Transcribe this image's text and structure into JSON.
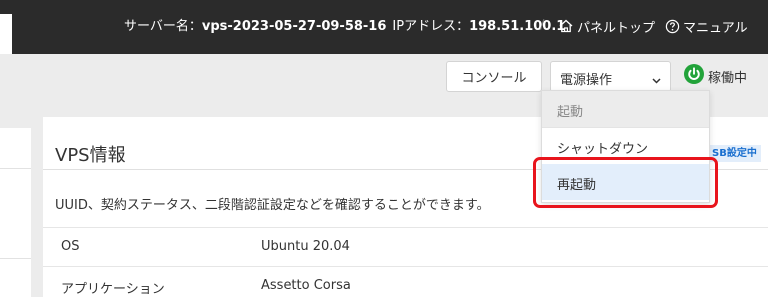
{
  "header": {
    "server_label": "サーバー名：",
    "server_name": "vps-2023-05-27-09-58-16",
    "ip_label": "IPアドレス：",
    "ip_address": "198.51.100.1",
    "separator": "/",
    "panel_top_label": "パネルトップ",
    "manual_label": "マニュアル",
    "icons": {
      "panel_top": "home-icon",
      "manual": "help-circle-icon"
    }
  },
  "toolbar": {
    "console_label": "コンソール",
    "power_select_value": "電源操作",
    "status_label": "稼働中",
    "status_color": "#22a33a"
  },
  "power_menu": {
    "items": [
      {
        "label": "起動",
        "disabled": true
      },
      {
        "label": "シャットダウン",
        "disabled": false
      },
      {
        "label": "再起動",
        "disabled": false,
        "hovered": true
      }
    ],
    "highlight_color": "#e8141c"
  },
  "card": {
    "title": "VPS情報",
    "badge": "SB設定中",
    "description": "UUID、契約ステータス、二段階認証設定などを確認することができます。",
    "rows": [
      {
        "key": "OS",
        "value": "Ubuntu 20.04"
      },
      {
        "key": "アプリケーション",
        "value": "Assetto Corsa"
      }
    ]
  },
  "colors": {
    "accent": "#1a6fcf",
    "topbar": "#2b2b2b",
    "hover_bg": "#e3eefb"
  }
}
